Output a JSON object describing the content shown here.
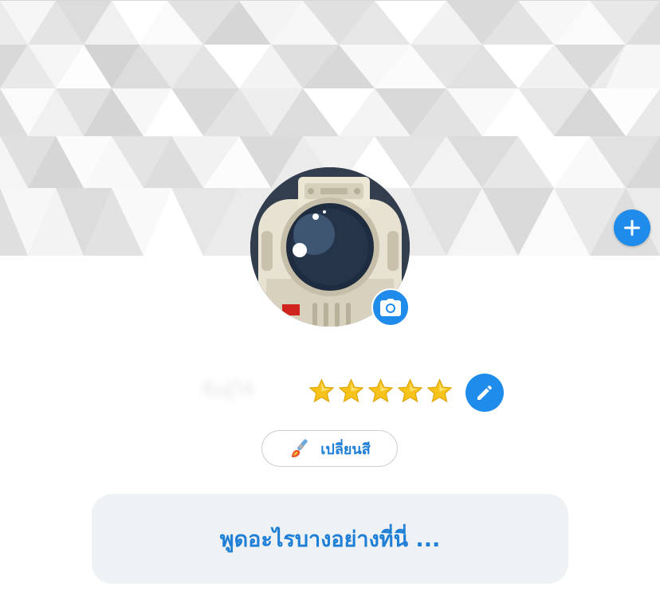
{
  "profile": {
    "name": "ชื่อผู้ใช้",
    "rating": 5,
    "rating_max": 5
  },
  "buttons": {
    "change_color_label": "เปลี่ยนสี"
  },
  "composer": {
    "placeholder": "พูดอะไรบางอย่างที่นี่ ..."
  },
  "icons": {
    "add_cover": "plus-icon",
    "change_avatar": "camera-icon",
    "edit_profile": "pencil-icon",
    "change_color": "paint-brush-icon",
    "star": "star-icon"
  },
  "colors": {
    "accent": "#1f8ceb",
    "link_text": "#1f7fd6",
    "composer_bg": "#eef2f5",
    "star": "#f7c21a"
  }
}
